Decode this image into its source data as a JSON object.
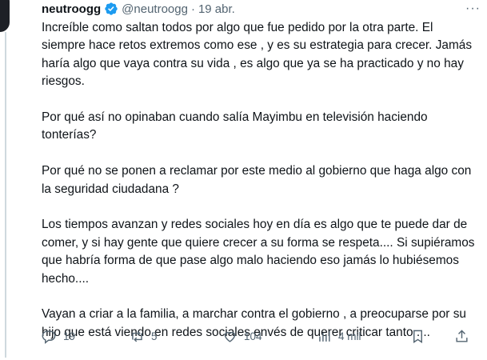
{
  "tweet": {
    "display_name": "neutroogg",
    "handle": "@neutroogg",
    "separator": "·",
    "date": "19 abr.",
    "more_label": "···",
    "paragraphs": [
      "Increíble como saltan todos por algo que fue pedido por la otra parte. El siempre hace retos extremos como ese , y es su estrategia para crecer. Jamás haría algo que vaya contra su vida , es algo que ya se ha practicado y no hay riesgos.",
      "Por qué así no opinaban cuando salía Mayimbu en televisión haciendo tonterías?",
      "Por qué no se ponen a reclamar por este medio al gobierno que haga algo con la seguridad ciudadana ?",
      "Los tiempos avanzan y redes sociales hoy en día es algo que te puede dar de comer, y si hay gente que quiere crecer a su forma se respeta.... Si supiéramos que habría forma de que pase algo malo haciendo eso jamás lo hubiésemos hecho....",
      "Vayan a criar a la familia, a marchar contra el gobierno , a preocuparse por su hijo que está viendo en redes sociales envés de querer criticar tanto ...."
    ]
  },
  "actions": {
    "replies": "19",
    "reposts": "5",
    "likes": "104",
    "views": "4 mil"
  },
  "colors": {
    "text": "#0f1419",
    "secondary": "#536471",
    "verified": "#1d9bf0"
  }
}
